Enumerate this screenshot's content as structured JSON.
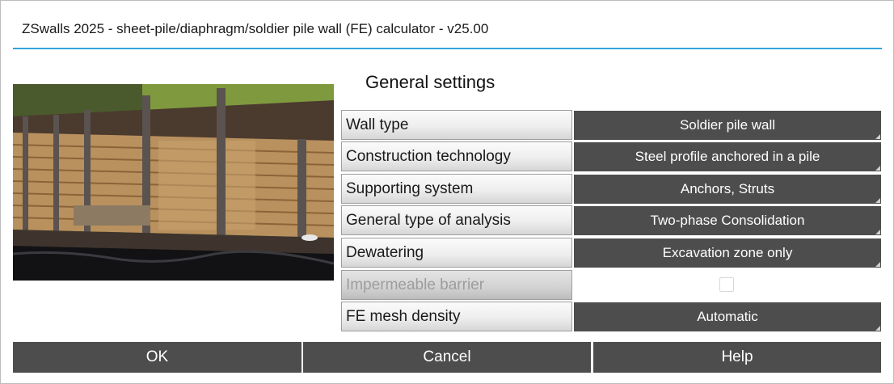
{
  "window": {
    "title": "ZSwalls 2025 - sheet-pile/diaphragm/soldier pile wall (FE) calculator - v25.00"
  },
  "section": {
    "heading": "General settings"
  },
  "settings": [
    {
      "label": "Wall type",
      "value": "Soldier pile wall",
      "enabled": true
    },
    {
      "label": "Construction technology",
      "value": "Steel profile anchored in a pile",
      "enabled": true
    },
    {
      "label": "Supporting system",
      "value": "Anchors, Struts",
      "enabled": true
    },
    {
      "label": "General type of analysis",
      "value": "Two-phase Consolidation",
      "enabled": true
    },
    {
      "label": "Dewatering",
      "value": "Excavation zone only",
      "enabled": true
    },
    {
      "label": "Impermeable barrier",
      "value": "",
      "enabled": false,
      "checked": false
    },
    {
      "label": "FE mesh density",
      "value": "Automatic",
      "enabled": true
    }
  ],
  "buttons": {
    "ok": "OK",
    "cancel": "Cancel",
    "help": "Help"
  },
  "colors": {
    "accent_line": "#33a3dc",
    "button_bg": "#4d4d4d",
    "button_text": "#ffffff"
  }
}
